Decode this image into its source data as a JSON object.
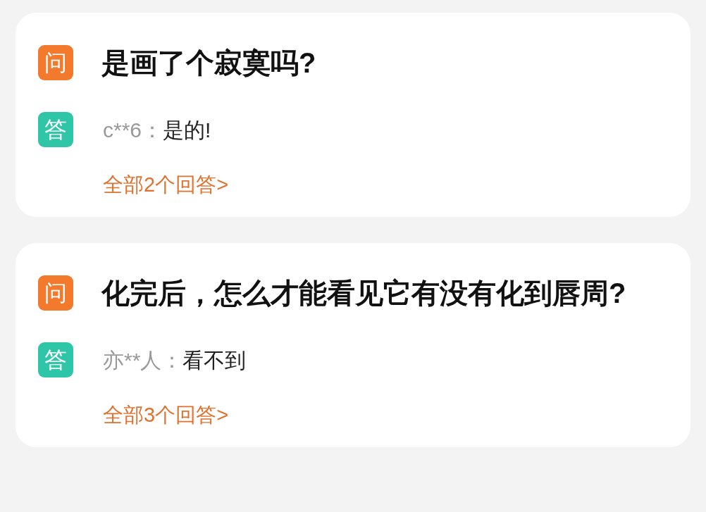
{
  "questions": [
    {
      "badge": "问",
      "question": "是画了个寂寞吗?",
      "answer_badge": "答",
      "user": "c**6：",
      "answer": "是的!",
      "more_link": "全部2个回答>"
    },
    {
      "badge": "问",
      "question": "化完后，怎么才能看见它有没有化到唇周?",
      "answer_badge": "答",
      "user": "亦**人：",
      "answer": "看不到",
      "more_link": "全部3个回答>"
    }
  ]
}
